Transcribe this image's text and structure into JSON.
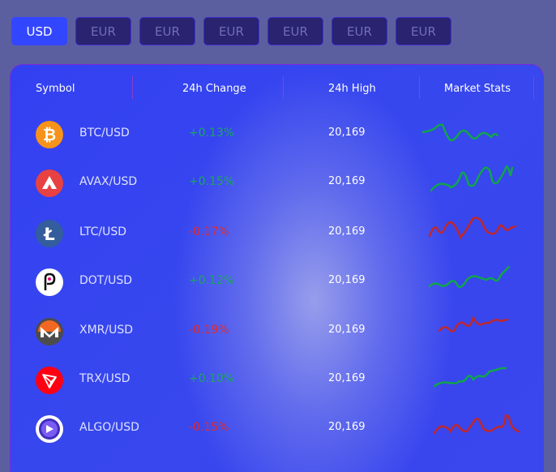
{
  "currency_tabs": [
    "USD",
    "EUR",
    "EUR",
    "EUR",
    "EUR",
    "EUR",
    "EUR"
  ],
  "table": {
    "headers": {
      "symbol": "Symbol",
      "change": "24h Change",
      "high": "24h High",
      "stats": "Market Stats"
    },
    "rows": [
      {
        "symbol": "BTC/USD",
        "change": "+0.13%",
        "high": "20,169",
        "trend": "up",
        "icon": "bitcoin-icon"
      },
      {
        "symbol": "AVAX/USD",
        "change": "+0.15%",
        "high": "20,169",
        "trend": "up",
        "icon": "avalanche-icon"
      },
      {
        "symbol": "LTC/USD",
        "change": "-0.17%",
        "high": "20,169",
        "trend": "down",
        "icon": "litecoin-icon"
      },
      {
        "symbol": "DOT/USD",
        "change": "+0.12%",
        "high": "20,169",
        "trend": "up",
        "icon": "polkadot-icon"
      },
      {
        "symbol": "XMR/USD",
        "change": "-0.19%",
        "high": "20,169",
        "trend": "down",
        "icon": "monero-icon"
      },
      {
        "symbol": "TRX/USD",
        "change": "+0.10%",
        "high": "20,169",
        "trend": "up",
        "icon": "tron-icon"
      },
      {
        "symbol": "ALGO/USD",
        "change": "-0.15%",
        "high": "20,169",
        "trend": "down",
        "icon": "algorand-icon"
      }
    ]
  },
  "colors": {
    "active_tab": "#3346ff",
    "positive": "#18a85a",
    "negative": "#e82828",
    "spark_up": "#11a54a",
    "spark_down": "#c0282c"
  }
}
